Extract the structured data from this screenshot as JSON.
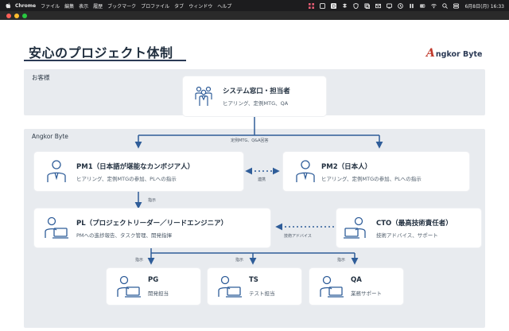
{
  "menubar": {
    "app": "Chrome",
    "items": [
      "ファイル",
      "編集",
      "表示",
      "履歴",
      "ブックマーク",
      "プロファイル",
      "タブ",
      "ウィンドウ",
      "ヘルプ"
    ],
    "clock": "6月8日(月) 16:33"
  },
  "slide": {
    "title": "安心のプロジェクト体制",
    "logo_mark": "A",
    "logo_text": "ngkor Byte",
    "customer_label": "お客様",
    "company_label": "Angkor Byte",
    "system_contact": {
      "title": "システム窓口・担当者",
      "sub": "ヒアリング、定例MTG、QA"
    },
    "pm1": {
      "title": "PM1（日本語が堪能なカンボジア人）",
      "sub": "ヒアリング、定例MTGの参加、PLへの指示"
    },
    "pm2": {
      "title": "PM2（日本人）",
      "sub": "ヒアリング、定例MTGの参加、PLへの指示"
    },
    "pl": {
      "title": "PL（プロジェクトリーダー／リードエンジニア）",
      "sub": "PMへの進捗報告、タスク管理、開発指揮"
    },
    "cto": {
      "title": "CTO（最高技術責任者）",
      "sub": "技術アドバイス、サポート"
    },
    "pg": {
      "title": "PG",
      "sub": "開発担当"
    },
    "ts": {
      "title": "TS",
      "sub": "テスト担当"
    },
    "qa": {
      "title": "QA",
      "sub": "業務サポート"
    },
    "labels": {
      "meeting": "定例MTG、Q&A回答",
      "coop": "連携",
      "instruct1": "指示",
      "advice": "技術アドバイス",
      "instruct_pg": "指示",
      "instruct_ts": "指示",
      "instruct_qa": "指示"
    },
    "colors": {
      "accent": "#2f5d99",
      "navy": "#2b3a55",
      "logo_red": "#c0392b",
      "band": "#e8ebef"
    }
  }
}
